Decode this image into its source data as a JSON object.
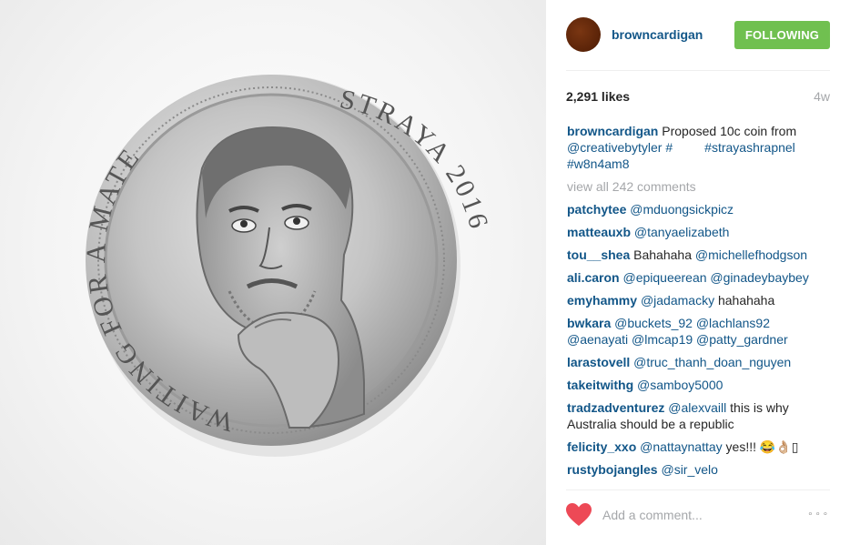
{
  "post": {
    "username": "browncardigan",
    "follow_label": "FOLLOWING",
    "likes": "2,291 likes",
    "time": "4w",
    "caption": {
      "user": "browncardigan",
      "text": "Proposed 10c coin from",
      "tags": [
        "@creativebytyler",
        "#",
        "#strayashrapnel",
        "#w8n4am8"
      ]
    },
    "view_all": "view all 242 comments",
    "comments": [
      {
        "user": "patchytee",
        "text": "@mduongsickpicz"
      },
      {
        "user": "matteauxb",
        "text": "@tanyaelizabeth"
      },
      {
        "user": "tou__shea",
        "text": "Bahahaha",
        "mention": "@michellefhodgson"
      },
      {
        "user": "ali.caron",
        "text": "@epiqueerean @ginadeybaybey"
      },
      {
        "user": "emyhammy",
        "mention": "@jadamacky",
        "text": "hahahaha"
      },
      {
        "user": "bwkara",
        "text": "@buckets_92 @lachlans92 @aenayati @lmcap19 @patty_gardner"
      },
      {
        "user": "larastovell",
        "text": "@truc_thanh_doan_nguyen"
      },
      {
        "user": "takeitwithg",
        "text": "@samboy5000"
      },
      {
        "user": "tradzadventurez",
        "mention": "@alexvaill",
        "text": "this is why Australia should be a republic"
      },
      {
        "user": "felicity_xxo",
        "mention": "@nattaynattay",
        "text": "yes!!! 😂👌🏼▯"
      },
      {
        "user": "rustybojangles",
        "text": "@sir_velo"
      }
    ],
    "add_comment_placeholder": "Add a comment...",
    "more_label": "∘∘∘"
  },
  "photo": {
    "coin_text_left": "WAITING FOR A MATE",
    "coin_text_right": "STRAYA 2016"
  },
  "colors": {
    "link": "#125688",
    "follow_green": "#70c050",
    "heart_red": "#ed4956",
    "muted": "#a5a7aa"
  }
}
